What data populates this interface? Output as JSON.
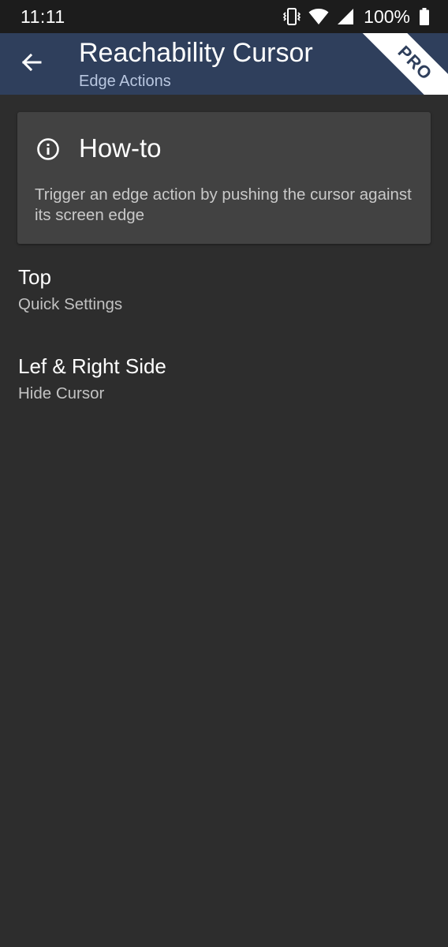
{
  "status_bar": {
    "time": "11:11",
    "battery": "100%",
    "icons": [
      "vibrate-icon",
      "wifi-icon",
      "cell-signal-icon",
      "battery-icon"
    ]
  },
  "app_bar": {
    "title": "Reachability Cursor",
    "subtitle": "Edge Actions",
    "pro_badge": "PRO",
    "back_icon": "back-arrow-icon",
    "color": "#2f3f5c"
  },
  "howto": {
    "icon": "info-icon",
    "title": "How-to",
    "body": "Trigger an edge action by pushing the cursor against its screen edge"
  },
  "preferences": [
    {
      "title": "Top",
      "summary": "Quick Settings"
    },
    {
      "title": "Lef & Right Side",
      "summary": "Hide Cursor"
    }
  ],
  "colors": {
    "background": "#2d2d2d",
    "card": "#424242",
    "status_bar": "#1c1c1c"
  }
}
